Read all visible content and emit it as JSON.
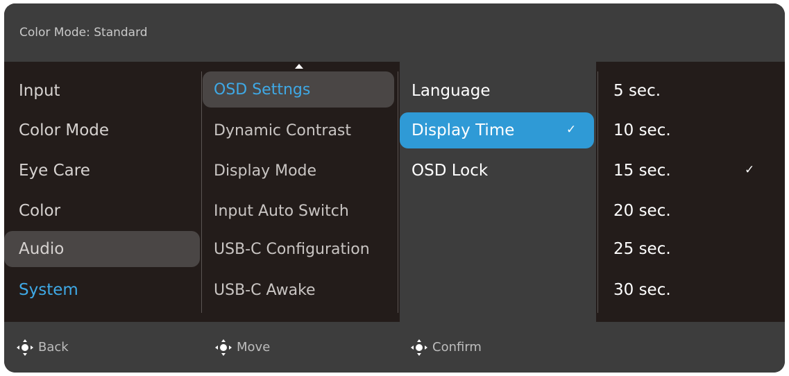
{
  "header": {
    "color_mode_text": "Color Mode: Standard"
  },
  "main_menu": {
    "items": [
      "Input",
      "Color Mode",
      "Eye Care",
      "Color",
      "Audio",
      "System"
    ]
  },
  "submenu": {
    "items": [
      "OSD Settngs",
      "Dynamic Contrast",
      "Display Mode",
      "Input Auto Switch",
      "USB-C Configuration",
      "USB-C Awake"
    ]
  },
  "osd_settings": {
    "items": [
      "Language",
      "Display Time",
      "OSD Lock"
    ]
  },
  "display_time_options": {
    "items": [
      "5 sec.",
      "10 sec.",
      "15 sec.",
      "20 sec.",
      "25 sec.",
      "30 sec."
    ]
  },
  "check_glyph": "✓",
  "footer": {
    "back_label": "Back",
    "move_label": "Move",
    "confirm_label": "Confirm"
  },
  "colors": {
    "accent": "#2f9ad6",
    "active_text": "#3fa9e6",
    "panel": "#231c1a",
    "bar": "#3d3d3d"
  }
}
